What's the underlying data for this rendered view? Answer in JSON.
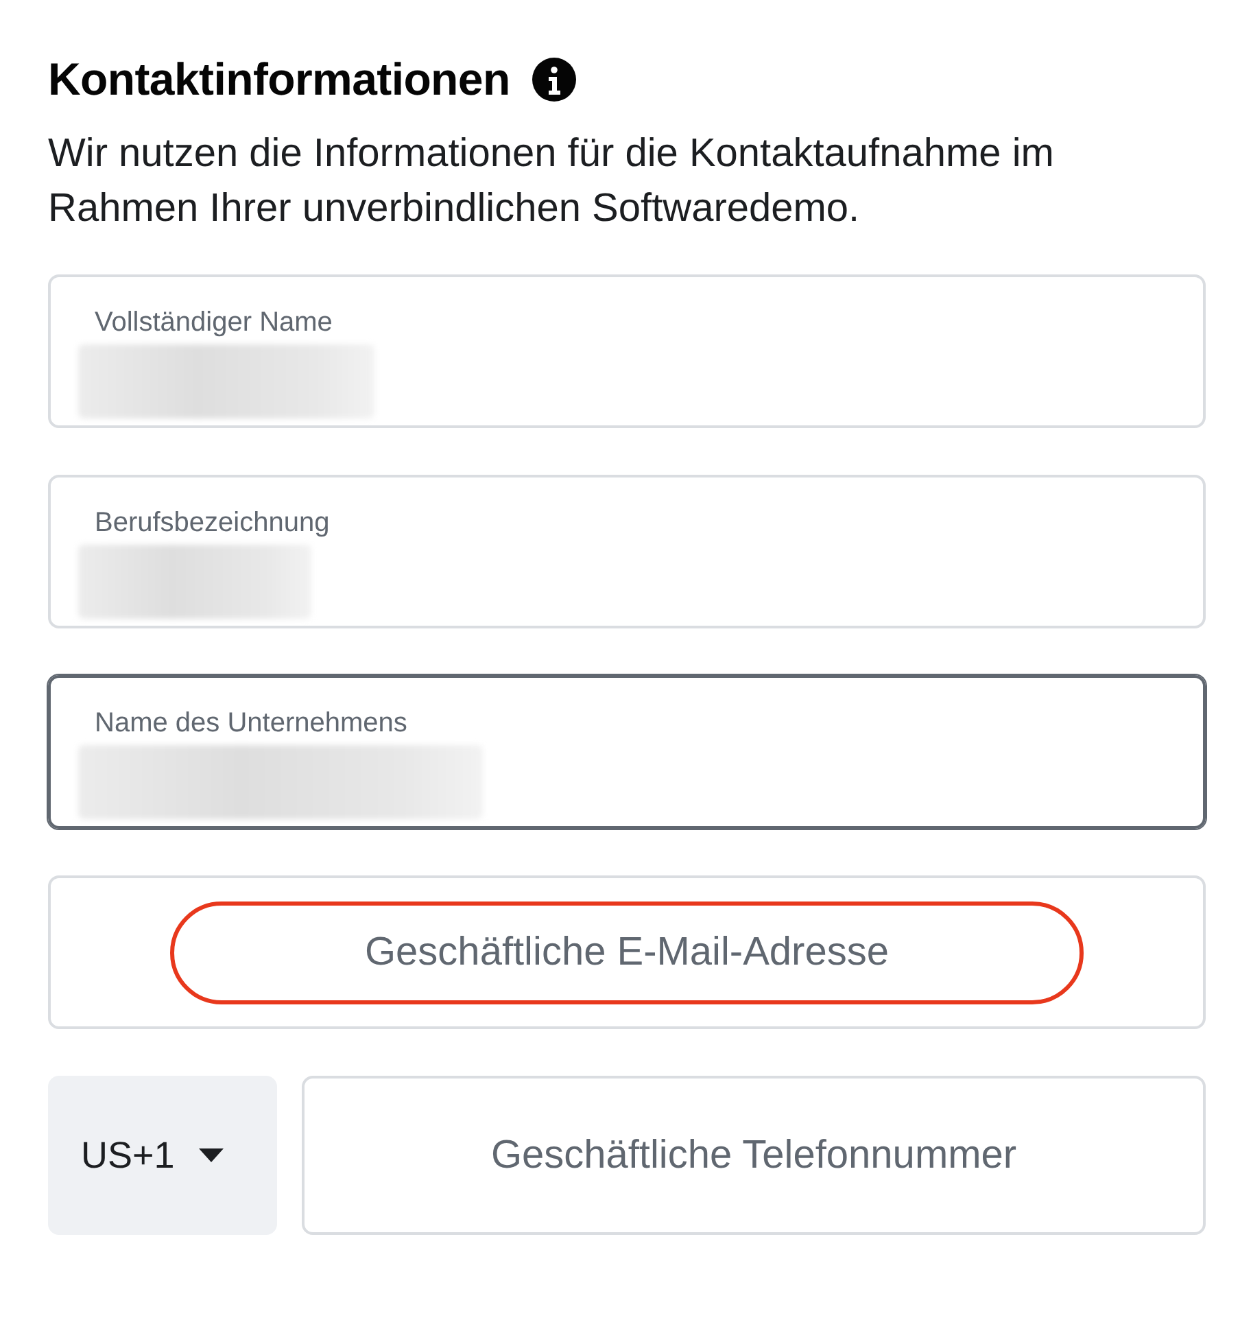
{
  "heading": {
    "title": "Kontaktinformationen"
  },
  "description": "Wir nutzen die Informationen für die Kontaktaufnahme im Rahmen Ihrer unverbindlichen Softwaredemo.",
  "fields": [
    {
      "kind": "filled",
      "label": "Vollständiger Name",
      "redacted": true,
      "focused": false
    },
    {
      "kind": "filled",
      "label": "Berufsbezeichnung",
      "redacted": true,
      "focused": false
    },
    {
      "kind": "filled",
      "label": "Name des Unternehmens",
      "redacted": true,
      "focused": true
    },
    {
      "kind": "empty",
      "placeholder": "Geschäftliche E-Mail-Adresse",
      "highlighted": true
    }
  ],
  "phone": {
    "country_code": "US+1",
    "placeholder": "Geschäftliche Telefonnummer"
  }
}
